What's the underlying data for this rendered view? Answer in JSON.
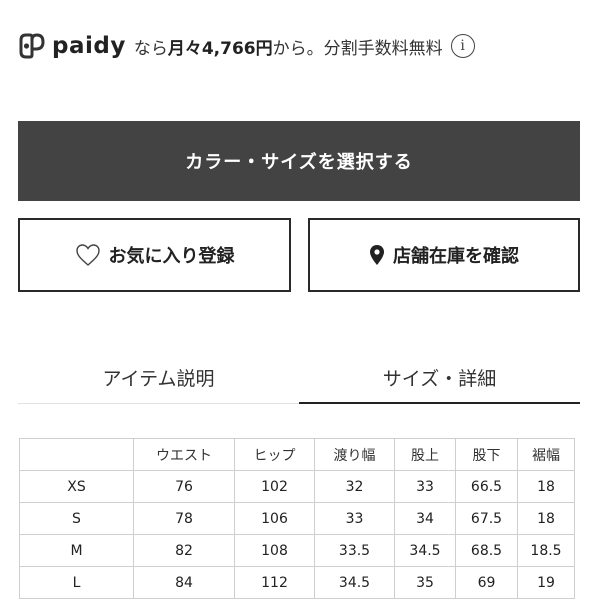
{
  "paidy": {
    "brand": "paidy",
    "prefix": "なら",
    "amount_text": "月々4,766円",
    "suffix": "から。分割手数料無料",
    "info": "i"
  },
  "buttons": {
    "select_label": "カラー・サイズを選択する",
    "favorite_label": "お気に入り登録",
    "store_label": "店舗在庫を確認"
  },
  "tabs": [
    {
      "label": "アイテム説明",
      "active": false
    },
    {
      "label": "サイズ・詳細",
      "active": true
    }
  ],
  "size_table": {
    "headers": [
      "",
      "ウエスト",
      "ヒップ",
      "渡り幅",
      "股上",
      "股下",
      "裾幅"
    ],
    "rows": [
      [
        "XS",
        "76",
        "102",
        "32",
        "33",
        "66.5",
        "18"
      ],
      [
        "S",
        "78",
        "106",
        "33",
        "34",
        "67.5",
        "18"
      ],
      [
        "M",
        "82",
        "108",
        "33.5",
        "34.5",
        "68.5",
        "18.5"
      ],
      [
        "L",
        "84",
        "112",
        "34.5",
        "35",
        "69",
        "19"
      ]
    ]
  },
  "colors": {
    "primary_button": "#434343",
    "border": "#2a2a2a",
    "table_border": "#cfcfcf"
  }
}
